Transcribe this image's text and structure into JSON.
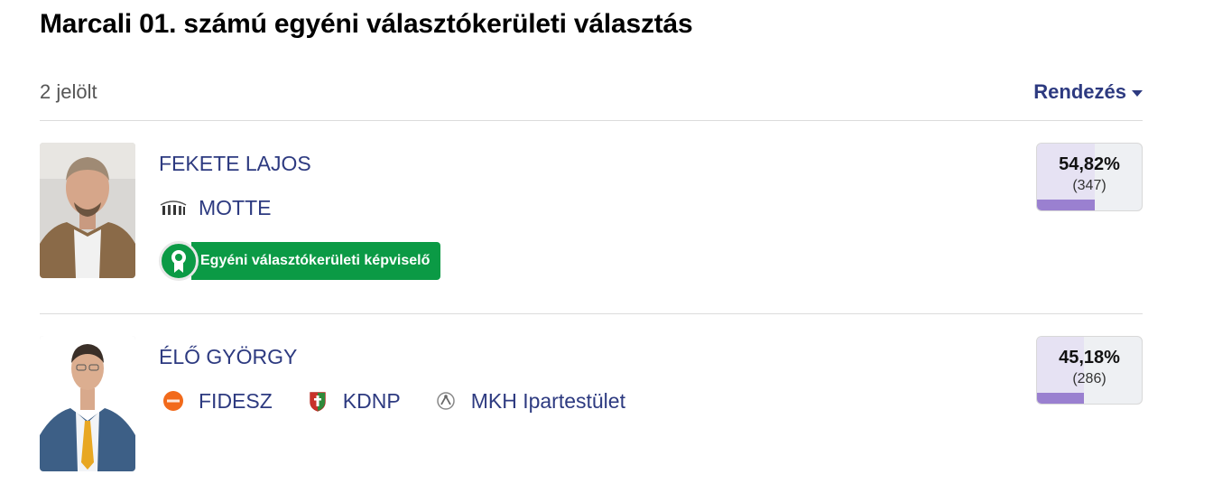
{
  "page": {
    "title": "Marcali 01. számú egyéni választókerületi választás"
  },
  "summary": {
    "count_label": "2 jelölt",
    "sort_label": "Rendezés"
  },
  "candidates": [
    {
      "name": "FEKETE LAJOS",
      "parties": [
        {
          "label": "MOTTE",
          "icon": "motte-logo"
        }
      ],
      "badge": "Egyéni választókerületi képviselő",
      "percent_label": "54,82%",
      "percent": 54.82,
      "votes_label": "(347)"
    },
    {
      "name": "ÉLŐ GYÖRGY",
      "parties": [
        {
          "label": "FIDESZ",
          "icon": "fidesz-logo"
        },
        {
          "label": "KDNP",
          "icon": "kdnp-logo"
        },
        {
          "label": "MKH Ipartestület",
          "icon": "mkh-logo"
        }
      ],
      "percent_label": "45,18%",
      "percent": 45.18,
      "votes_label": "(286)"
    }
  ],
  "colors": {
    "accent": "#2d3a80",
    "badge": "#0b9a45",
    "bar": "#9a80d0",
    "bar_bg": "#e6e2f3"
  }
}
